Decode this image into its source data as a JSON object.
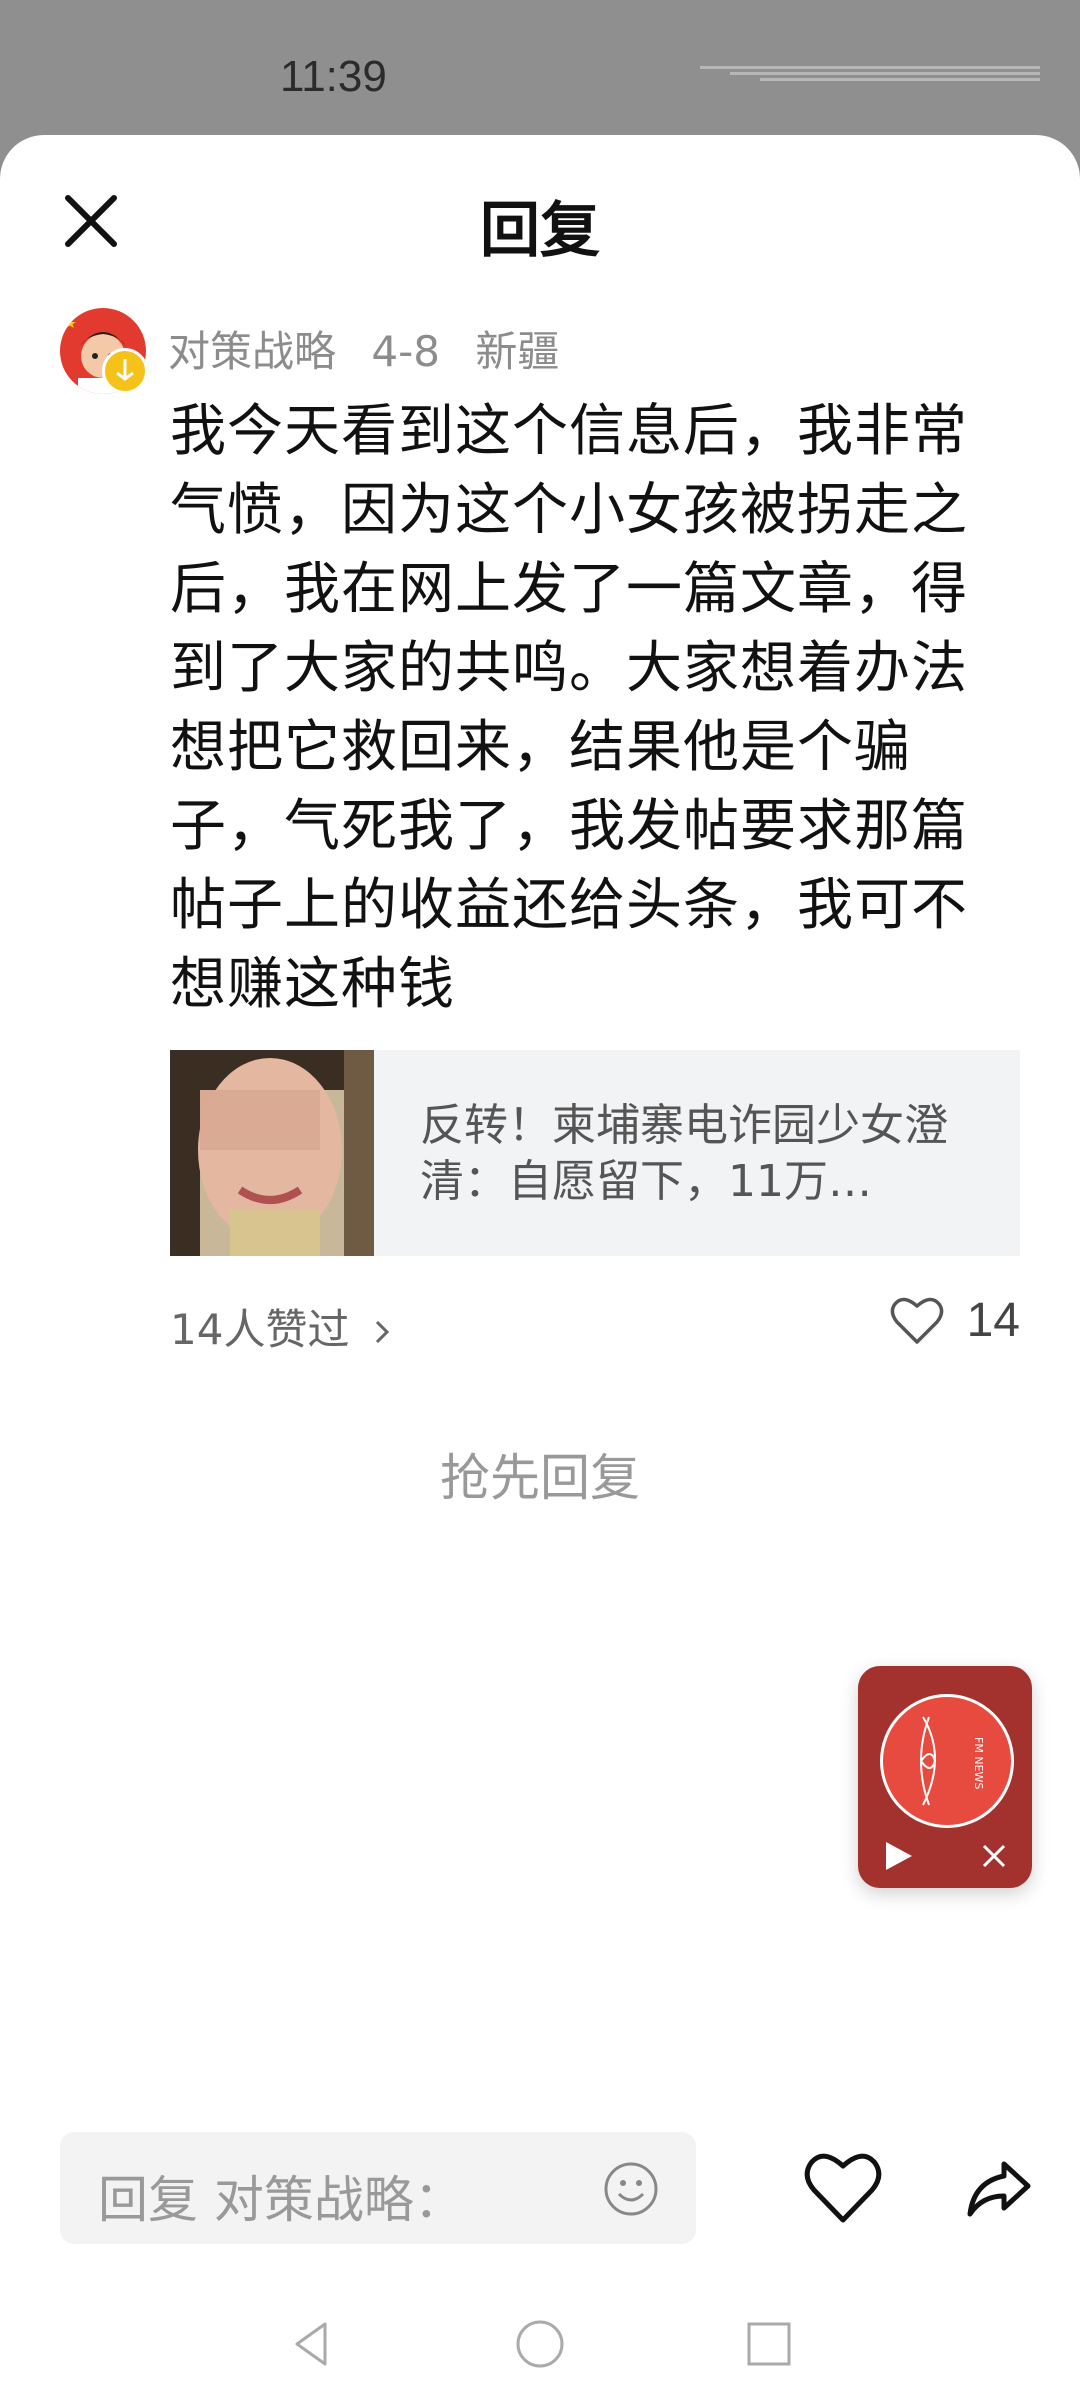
{
  "status_bar": {
    "time": "11:39"
  },
  "header": {
    "title": "回复",
    "close_icon": "close-icon"
  },
  "comment": {
    "author": "对策战略",
    "date": "4-8",
    "location": "新疆",
    "text": "我今天看到这个信息后，我非常气愤，因为这个小女孩被拐走之后，我在网上发了一篇文章，得到了大家的共鸣。大家想着办法想把它救回来，结果他是个骗子，气死我了，我发帖要求那篇帖子上的收益还给头条，我可不想赚这种钱",
    "link_card": {
      "title": "反转！柬埔寨电诈园少女澄清：自愿留下，11万…"
    },
    "likes_summary": "14人赞过",
    "like_count": "14"
  },
  "first_reply_prompt": "抢先回复",
  "fm_widget": {
    "brand_text": "FM NEWS",
    "accent_color": "#a3322f"
  },
  "bottom_bar": {
    "reply_placeholder": "回复 对策战略："
  }
}
